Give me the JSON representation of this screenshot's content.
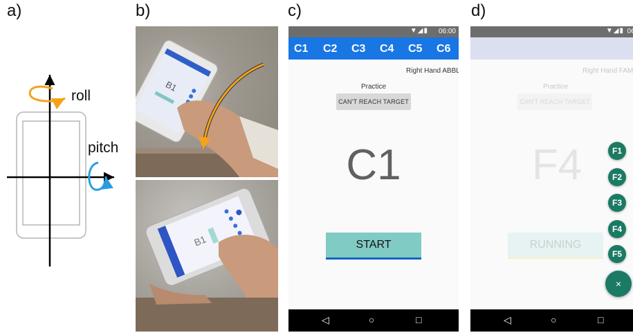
{
  "panels": {
    "a": {
      "letter": "a)",
      "roll_label": "roll",
      "pitch_label": "pitch"
    },
    "b": {
      "letter": "b)",
      "screen_text": "B1"
    },
    "c": {
      "letter": "c)"
    },
    "d": {
      "letter": "d)"
    }
  },
  "phone_c": {
    "time": "06:00",
    "tabs": [
      "C1",
      "C2",
      "C3",
      "C4",
      "C5",
      "C6"
    ],
    "hand_text": "Right Hand   ABBL",
    "practice_label": "Practice",
    "reach_button": "CAN'T REACH TARGET",
    "target": "C1",
    "action_button": "START"
  },
  "phone_d": {
    "time": "06:0",
    "hand_text": "Right Hand   FAM",
    "practice_label": "Practice",
    "reach_button": "CAN'T REACH TARGET",
    "target": "F4",
    "action_button": "RUNNING",
    "fab_items": [
      "F1",
      "F2",
      "F3",
      "F4",
      "F5"
    ],
    "close_label": "×"
  },
  "colors": {
    "accent_blue": "#1976e5",
    "arrow_orange": "#f5a21b",
    "arrow_blue": "#2a9de0",
    "fab_green": "#1b7a64",
    "start_teal": "#80cbc4"
  }
}
